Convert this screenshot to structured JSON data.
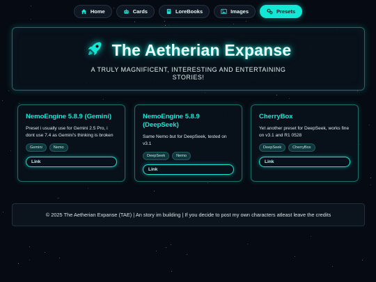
{
  "nav": {
    "items": [
      {
        "label": "Home",
        "icon": "home-icon"
      },
      {
        "label": "Cards",
        "icon": "robot-icon"
      },
      {
        "label": "LoreBooks",
        "icon": "book-icon"
      },
      {
        "label": "Images",
        "icon": "image-icon"
      },
      {
        "label": "Presets",
        "icon": "gears-icon",
        "active": true
      }
    ]
  },
  "hero": {
    "icon": "rocket-icon",
    "title": "The Aetherian Expanse",
    "subtitle": "A TRULY MAGNIFICENT, INTERESTING AND ENTERTAINING STORIES!"
  },
  "cards": [
    {
      "title": "NemoEngine 5.8.9 (Gemini)",
      "description": "Preset i usually use for Gemini 2.5 Pro, i dont use 7.4 as Gemini's thinking is broken",
      "tags": [
        "Gemini",
        "Nemo"
      ],
      "link_label": "Link"
    },
    {
      "title": "NemoEngine 5.8.9 (DeepSeek)",
      "description": "Same Nemo but for DeepSeek, tested on v3.1",
      "tags": [
        "DeepSeek",
        "Nemo"
      ],
      "link_label": "Link"
    },
    {
      "title": "CherryBox",
      "description": "Yet another preset for DeepSeek, works fine on v3.1 and R1 0528",
      "tags": [
        "DeepSeek",
        "CherryBox"
      ],
      "link_label": "Link"
    }
  ],
  "footer": {
    "text": "© 2025 The Aetherian Expanse (TAE) | An story im building | If you decide to post my own characters atleast leave the credits"
  },
  "colors": {
    "accent": "#12e8d4",
    "background": "#060a12",
    "card_border": "#1a6f6a"
  }
}
